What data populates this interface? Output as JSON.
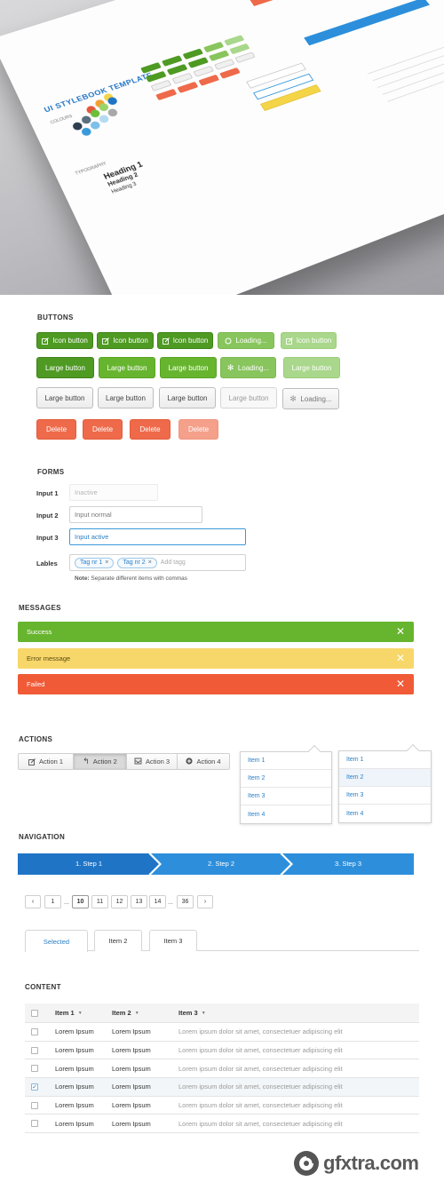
{
  "hero": {
    "title": "UI STYLEBOOK TEMPLATE",
    "colours_label": "COLOURS",
    "typography_label": "TYPOGRAPHY",
    "heading1": "Heading 1",
    "heading2": "Heading 2",
    "heading3": "Heading 3",
    "swatches": [
      "#e8563a",
      "#f0a030",
      "#f5d548",
      "#2d3e50",
      "#5a6f80",
      "#6cbf3a",
      "#9ad36a",
      "#1f74c6",
      "#3a99db",
      "#7cc0ea",
      "#b5dbf2",
      "#a8a8a8"
    ]
  },
  "buttons": {
    "heading": "BUTTONS",
    "icon_button": "Icon button",
    "loading": "Loading...",
    "large_button": "Large button",
    "delete": "Delete"
  },
  "forms": {
    "heading": "FORMS",
    "input1_label": "Input 1",
    "input1_value": "Inactive",
    "input2_label": "Input 2",
    "input2_value": "Input normal",
    "input3_label": "Input 3",
    "input3_value": "Input active",
    "labels_label": "Lables",
    "tags": [
      "Tag nr 1",
      "Tag nr 2"
    ],
    "tag_placeholder": "Add tagg",
    "note_bold": "Note:",
    "note_text": "Separate different items with commas"
  },
  "messages": {
    "heading": "MESSAGES",
    "items": [
      {
        "text": "Success",
        "bg": "#67b52f",
        "fg": "#ffffff"
      },
      {
        "text": "Error message",
        "bg": "#f7d76a",
        "fg": "#5a4a10"
      },
      {
        "text": "Failed",
        "bg": "#f05a37",
        "fg": "#ffffff"
      }
    ]
  },
  "actions": {
    "heading": "ACTIONS",
    "buttons": [
      "Action 1",
      "Action 2",
      "Action 3",
      "Action 4"
    ],
    "dropdown_items": [
      "Item 1",
      "Item 2",
      "Item 3",
      "Item 4"
    ]
  },
  "navigation": {
    "heading": "NAVIGATION",
    "steps": [
      "1. Step 1",
      "2. Step 2",
      "3. Step 3"
    ],
    "pages": [
      "1",
      "10",
      "11",
      "12",
      "13",
      "14",
      "36"
    ],
    "current_page": "10",
    "ellipsis": "...",
    "tabs": [
      "Selected",
      "Item 2",
      "Item 3"
    ]
  },
  "content": {
    "heading": "CONTENT",
    "columns": [
      "Item 1",
      "Item 2",
      "Item 3"
    ],
    "rows": [
      {
        "c1": "Lorem Ipsum",
        "c2": "Lorem Ipsum",
        "c3": "Lorem ipsum dolor sit amet, consectetuer adipiscing elit",
        "checked": false
      },
      {
        "c1": "Lorem Ipsum",
        "c2": "Lorem Ipsum",
        "c3": "Lorem ipsum dolor sit amet, consectetuer adipiscing elit",
        "checked": false
      },
      {
        "c1": "Lorem Ipsum",
        "c2": "Lorem Ipsum",
        "c3": "Lorem ipsum dolor sit amet, consectetuer adipiscing elit",
        "checked": false
      },
      {
        "c1": "Lorem Ipsum",
        "c2": "Lorem Ipsum",
        "c3": "Lorem ipsum dolor sit amet, consectetuer adipiscing elit",
        "checked": true
      },
      {
        "c1": "Lorem Ipsum",
        "c2": "Lorem Ipsum",
        "c3": "Lorem ipsum dolor sit amet, consectetuer adipiscing elit",
        "checked": false
      },
      {
        "c1": "Lorem Ipsum",
        "c2": "Lorem Ipsum",
        "c3": "Lorem ipsum dolor sit amet, consectetuer adipiscing elit",
        "checked": false
      }
    ]
  },
  "watermark": {
    "text": "gfxtra.com"
  },
  "colors": {
    "accent_blue": "#2a7fc6",
    "green": "#67b52f",
    "red": "#ee6a4a",
    "step_dark": "#1f74c6",
    "step_light": "#2d8fdb"
  }
}
